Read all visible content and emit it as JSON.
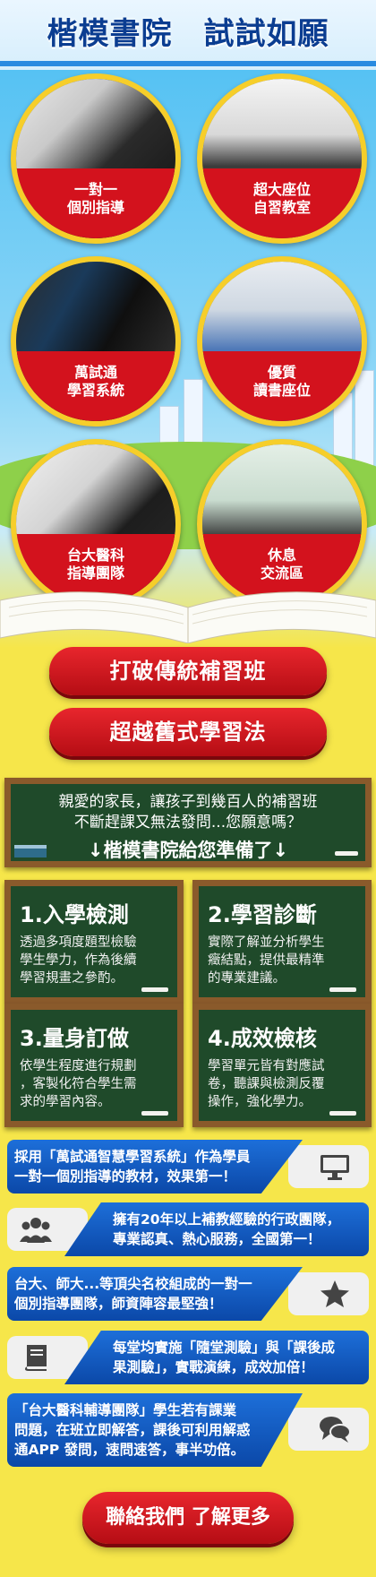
{
  "header": {
    "title": "楷模書院　試試如願"
  },
  "features": [
    {
      "line1": "一對一",
      "line2": "個別指導",
      "icon": "tutoring-photo"
    },
    {
      "line1": "超大座位",
      "line2": "自習教室",
      "icon": "classroom-photo"
    },
    {
      "line1": "萬試通",
      "line2": "學習系統",
      "icon": "computer-photo"
    },
    {
      "line1": "優質",
      "line2": "讀書座位",
      "icon": "cubicle-photo"
    },
    {
      "line1": "台大醫科",
      "line2": "指導團隊",
      "icon": "team-photo"
    },
    {
      "line1": "休息",
      "line2": "交流區",
      "icon": "lounge-photo"
    }
  ],
  "buttons": {
    "break_traditional": "打破傳統補習班",
    "beyond_old": "超越舊式學習法"
  },
  "board": {
    "line1": "親愛的家長，讓孩子到幾百人的補習班",
    "line2": "不斷趕課又無法發問...您願意嗎？",
    "line3": "↓楷模書院給您準備了↓"
  },
  "cards": [
    {
      "title": "1.入學檢測",
      "l1": "透過多項度題型檢驗",
      "l2": "學生學力，作為後續",
      "l3": "學習規畫之參酌。"
    },
    {
      "title": "2.學習診斷",
      "l1": "實際了解並分析學生",
      "l2": "癥結點，提供最精準",
      "l3": "的專業建議。"
    },
    {
      "title": "3.量身訂做",
      "l1": "依學生程度進行規劃",
      "l2": "，客製化符合學生需",
      "l3": "求的學習內容。"
    },
    {
      "title": "4.成效檢核",
      "l1": "學習單元皆有對應試",
      "l2": "卷，聽課與檢測反覆",
      "l3": "操作，強化學力。"
    }
  ],
  "banners": [
    {
      "l1": "採用「萬試通智慧學習系統」作為學員",
      "l2": "一對一個別指導的教材，效果第一！",
      "icon": "monitor-icon"
    },
    {
      "l1": "擁有20年以上補教經驗的行政團隊，",
      "l2": "專業認真、熱心服務，全國第一！",
      "icon": "group-icon"
    },
    {
      "l1": "台大、師大...等頂尖名校組成的一對一",
      "l2": "個別指導團隊，師資陣容最堅強！",
      "icon": "star-icon"
    },
    {
      "l1": "每堂均實施「隨堂測驗」與「課後成",
      "l2": "果測驗」，實戰演練，成效加倍！",
      "icon": "book-icon"
    },
    {
      "l1": "「台大醫科輔導團隊」學生若有課業",
      "l2": "問題，在班立即解答，課後可利用解惑",
      "l3": "通APP 發問，速問速答，事半功倍。",
      "icon": "chat-icon"
    }
  ],
  "cta": {
    "label": "聯絡我們 了解更多"
  }
}
